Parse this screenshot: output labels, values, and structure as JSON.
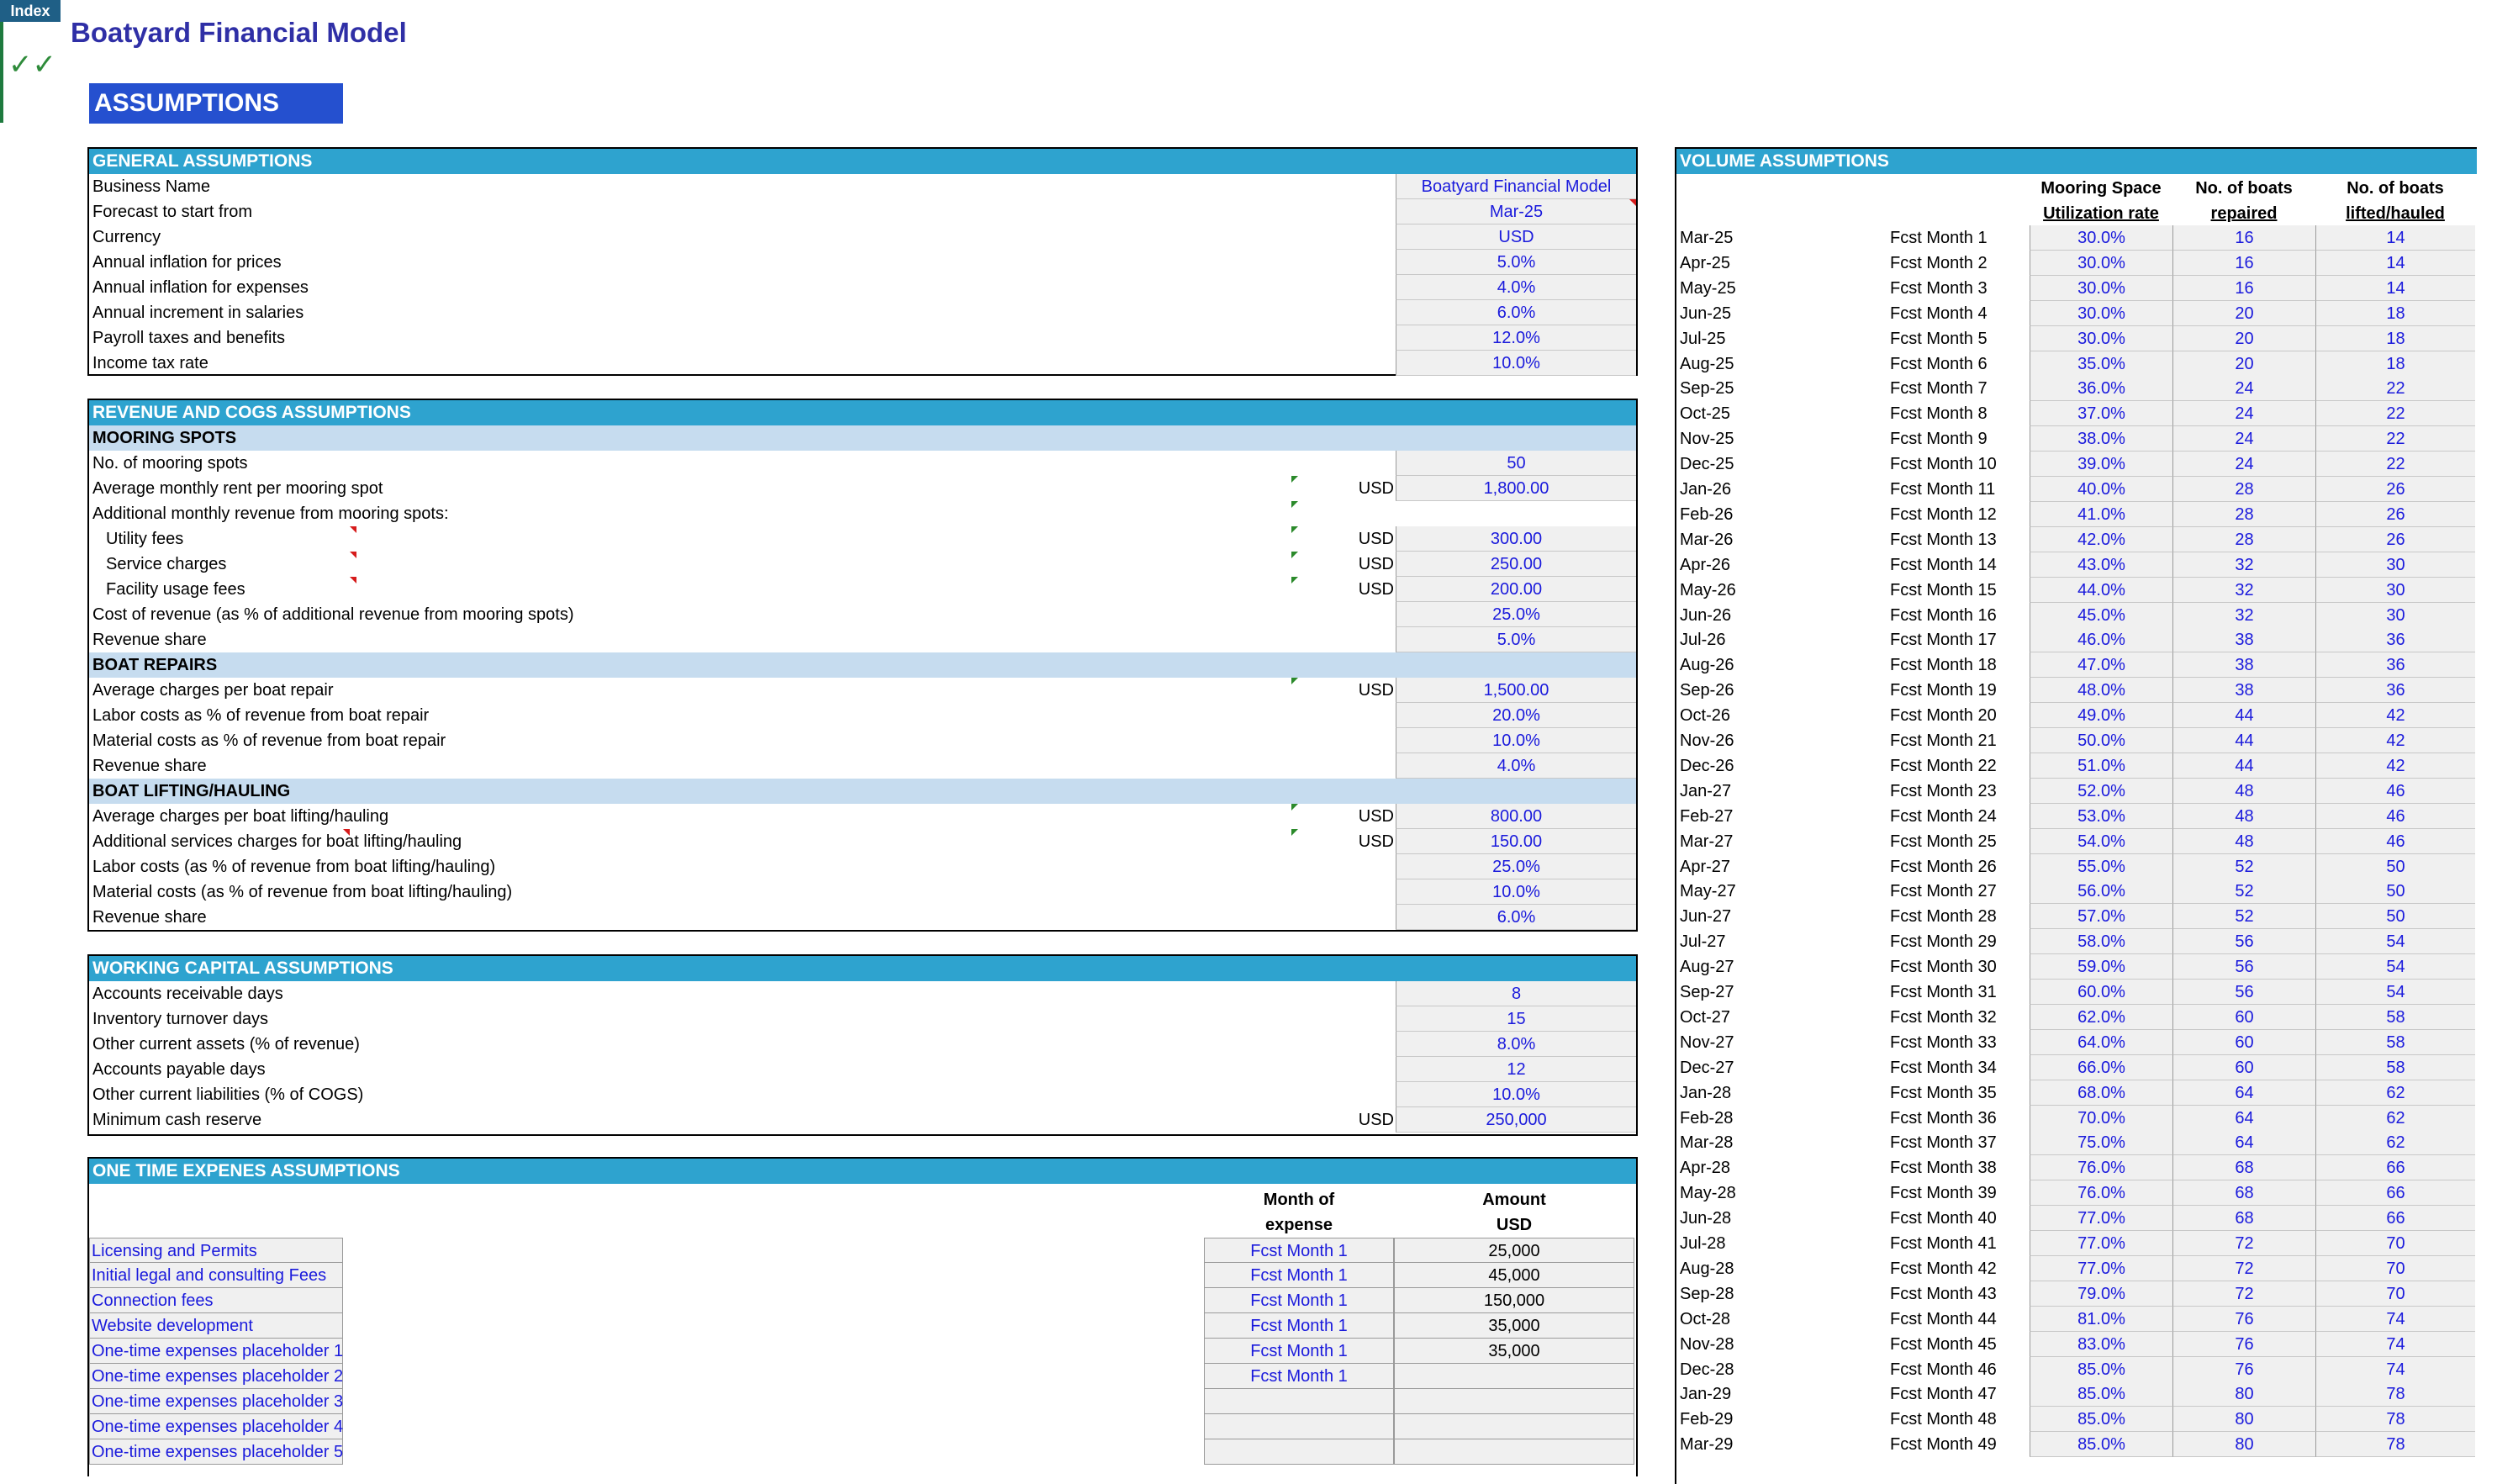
{
  "nav": {
    "index_label": "Index",
    "check_glyph": "✓✓"
  },
  "title": "Boatyard Financial Model",
  "banner": "ASSUMPTIONS",
  "general": {
    "header": "GENERAL ASSUMPTIONS",
    "rows": [
      {
        "label": "Business Name",
        "value": "Boatyard Financial Model"
      },
      {
        "label": "Forecast to start from",
        "value": "Mar-25"
      },
      {
        "label": "Currency",
        "value": "USD"
      },
      {
        "label": "Annual inflation for prices",
        "value": "5.0%"
      },
      {
        "label": "Annual inflation for expenses",
        "value": "4.0%"
      },
      {
        "label": "Annual increment in salaries",
        "value": "6.0%"
      },
      {
        "label": "Payroll taxes and benefits",
        "value": "12.0%"
      },
      {
        "label": "Income tax rate",
        "value": "10.0%"
      }
    ]
  },
  "revenue": {
    "header": "REVENUE AND COGS ASSUMPTIONS",
    "mooring": {
      "header": "MOORING SPOTS",
      "rows": [
        {
          "label": "No. of mooring spots",
          "unit": "",
          "value": "50"
        },
        {
          "label": "Average monthly rent per mooring spot",
          "unit": "USD",
          "value": "1,800.00"
        },
        {
          "label": "Additional monthly revenue from mooring spots:",
          "unit": "",
          "value": ""
        },
        {
          "label": "Utility fees",
          "unit": "USD",
          "value": "300.00"
        },
        {
          "label": "Service charges",
          "unit": "USD",
          "value": "250.00"
        },
        {
          "label": "Facility usage fees",
          "unit": "USD",
          "value": "200.00"
        },
        {
          "label": "Cost of revenue (as % of additional revenue from mooring spots)",
          "unit": "",
          "value": "25.0%"
        },
        {
          "label": "Revenue share",
          "unit": "",
          "value": "5.0%"
        }
      ]
    },
    "repairs": {
      "header": "BOAT REPAIRS",
      "rows": [
        {
          "label": "Average charges per boat repair",
          "unit": "USD",
          "value": "1,500.00"
        },
        {
          "label": "Labor costs as % of revenue from boat repair",
          "unit": "",
          "value": "20.0%"
        },
        {
          "label": "Material costs as % of revenue from boat repair",
          "unit": "",
          "value": "10.0%"
        },
        {
          "label": "Revenue share",
          "unit": "",
          "value": "4.0%"
        }
      ]
    },
    "lifting": {
      "header": "BOAT LIFTING/HAULING",
      "rows": [
        {
          "label": "Average charges per boat lifting/hauling",
          "unit": "USD",
          "value": "800.00"
        },
        {
          "label": "Additional services charges for boat lifting/hauling",
          "unit": "USD",
          "value": "150.00"
        },
        {
          "label": "Labor costs (as % of revenue from boat lifting/hauling)",
          "unit": "",
          "value": "25.0%"
        },
        {
          "label": "Material costs (as % of revenue from boat lifting/hauling)",
          "unit": "",
          "value": "10.0%"
        },
        {
          "label": "Revenue share",
          "unit": "",
          "value": "6.0%"
        }
      ]
    }
  },
  "working_capital": {
    "header": "WORKING CAPITAL ASSUMPTIONS",
    "rows": [
      {
        "label": "Accounts receivable days",
        "unit": "",
        "value": "8"
      },
      {
        "label": "Inventory turnover days",
        "unit": "",
        "value": "15"
      },
      {
        "label": "Other current assets (% of revenue)",
        "unit": "",
        "value": "8.0%"
      },
      {
        "label": "Accounts payable days",
        "unit": "",
        "value": "12"
      },
      {
        "label": "Other current liabilities (% of COGS)",
        "unit": "",
        "value": "10.0%"
      },
      {
        "label": "Minimum cash reserve",
        "unit": "USD",
        "value": "250,000"
      }
    ]
  },
  "one_time": {
    "header": "ONE TIME EXPENES ASSUMPTIONS",
    "col_month_1": "Month of",
    "col_month_2": "expense",
    "col_amount_1": "Amount",
    "col_amount_2": "USD",
    "rows": [
      {
        "name": "Licensing and Permits",
        "month": "Fcst Month 1",
        "amount": "25,000"
      },
      {
        "name": "Initial legal and consulting Fees",
        "month": "Fcst Month 1",
        "amount": "45,000"
      },
      {
        "name": "Connection fees",
        "month": "Fcst Month 1",
        "amount": "150,000"
      },
      {
        "name": "Website development",
        "month": "Fcst Month 1",
        "amount": "35,000"
      },
      {
        "name": "One-time expenses placeholder 1",
        "month": "Fcst Month 1",
        "amount": "35,000"
      },
      {
        "name": "One-time expenses placeholder 2",
        "month": "Fcst Month 1",
        "amount": ""
      },
      {
        "name": "One-time expenses placeholder 3",
        "month": "",
        "amount": ""
      },
      {
        "name": "One-time expenses placeholder 4",
        "month": "",
        "amount": ""
      },
      {
        "name": "One-time expenses placeholder 5",
        "month": "",
        "amount": ""
      }
    ]
  },
  "volume": {
    "header": "VOLUME ASSUMPTIONS",
    "col1_a": "Mooring Space",
    "col1_b": "Utilization rate",
    "col2_a": "No. of boats",
    "col2_b": "repaired",
    "col3_a": "No. of boats",
    "col3_b": "lifted/hauled",
    "rows": [
      [
        "Mar-25",
        "Fcst Month 1",
        "30.0%",
        "16",
        "14"
      ],
      [
        "Apr-25",
        "Fcst Month 2",
        "30.0%",
        "16",
        "14"
      ],
      [
        "May-25",
        "Fcst Month 3",
        "30.0%",
        "16",
        "14"
      ],
      [
        "Jun-25",
        "Fcst Month 4",
        "30.0%",
        "20",
        "18"
      ],
      [
        "Jul-25",
        "Fcst Month 5",
        "30.0%",
        "20",
        "18"
      ],
      [
        "Aug-25",
        "Fcst Month 6",
        "35.0%",
        "20",
        "18"
      ],
      [
        "Sep-25",
        "Fcst Month 7",
        "36.0%",
        "24",
        "22"
      ],
      [
        "Oct-25",
        "Fcst Month 8",
        "37.0%",
        "24",
        "22"
      ],
      [
        "Nov-25",
        "Fcst Month 9",
        "38.0%",
        "24",
        "22"
      ],
      [
        "Dec-25",
        "Fcst Month 10",
        "39.0%",
        "24",
        "22"
      ],
      [
        "Jan-26",
        "Fcst Month 11",
        "40.0%",
        "28",
        "26"
      ],
      [
        "Feb-26",
        "Fcst Month 12",
        "41.0%",
        "28",
        "26"
      ],
      [
        "Mar-26",
        "Fcst Month 13",
        "42.0%",
        "28",
        "26"
      ],
      [
        "Apr-26",
        "Fcst Month 14",
        "43.0%",
        "32",
        "30"
      ],
      [
        "May-26",
        "Fcst Month 15",
        "44.0%",
        "32",
        "30"
      ],
      [
        "Jun-26",
        "Fcst Month 16",
        "45.0%",
        "32",
        "30"
      ],
      [
        "Jul-26",
        "Fcst Month 17",
        "46.0%",
        "38",
        "36"
      ],
      [
        "Aug-26",
        "Fcst Month 18",
        "47.0%",
        "38",
        "36"
      ],
      [
        "Sep-26",
        "Fcst Month 19",
        "48.0%",
        "38",
        "36"
      ],
      [
        "Oct-26",
        "Fcst Month 20",
        "49.0%",
        "44",
        "42"
      ],
      [
        "Nov-26",
        "Fcst Month 21",
        "50.0%",
        "44",
        "42"
      ],
      [
        "Dec-26",
        "Fcst Month 22",
        "51.0%",
        "44",
        "42"
      ],
      [
        "Jan-27",
        "Fcst Month 23",
        "52.0%",
        "48",
        "46"
      ],
      [
        "Feb-27",
        "Fcst Month 24",
        "53.0%",
        "48",
        "46"
      ],
      [
        "Mar-27",
        "Fcst Month 25",
        "54.0%",
        "48",
        "46"
      ],
      [
        "Apr-27",
        "Fcst Month 26",
        "55.0%",
        "52",
        "50"
      ],
      [
        "May-27",
        "Fcst Month 27",
        "56.0%",
        "52",
        "50"
      ],
      [
        "Jun-27",
        "Fcst Month 28",
        "57.0%",
        "52",
        "50"
      ],
      [
        "Jul-27",
        "Fcst Month 29",
        "58.0%",
        "56",
        "54"
      ],
      [
        "Aug-27",
        "Fcst Month 30",
        "59.0%",
        "56",
        "54"
      ],
      [
        "Sep-27",
        "Fcst Month 31",
        "60.0%",
        "56",
        "54"
      ],
      [
        "Oct-27",
        "Fcst Month 32",
        "62.0%",
        "60",
        "58"
      ],
      [
        "Nov-27",
        "Fcst Month 33",
        "64.0%",
        "60",
        "58"
      ],
      [
        "Dec-27",
        "Fcst Month 34",
        "66.0%",
        "60",
        "58"
      ],
      [
        "Jan-28",
        "Fcst Month 35",
        "68.0%",
        "64",
        "62"
      ],
      [
        "Feb-28",
        "Fcst Month 36",
        "70.0%",
        "64",
        "62"
      ],
      [
        "Mar-28",
        "Fcst Month 37",
        "75.0%",
        "64",
        "62"
      ],
      [
        "Apr-28",
        "Fcst Month 38",
        "76.0%",
        "68",
        "66"
      ],
      [
        "May-28",
        "Fcst Month 39",
        "76.0%",
        "68",
        "66"
      ],
      [
        "Jun-28",
        "Fcst Month 40",
        "77.0%",
        "68",
        "66"
      ],
      [
        "Jul-28",
        "Fcst Month 41",
        "77.0%",
        "72",
        "70"
      ],
      [
        "Aug-28",
        "Fcst Month 42",
        "77.0%",
        "72",
        "70"
      ],
      [
        "Sep-28",
        "Fcst Month 43",
        "79.0%",
        "72",
        "70"
      ],
      [
        "Oct-28",
        "Fcst Month 44",
        "81.0%",
        "76",
        "74"
      ],
      [
        "Nov-28",
        "Fcst Month 45",
        "83.0%",
        "76",
        "74"
      ],
      [
        "Dec-28",
        "Fcst Month 46",
        "85.0%",
        "76",
        "74"
      ],
      [
        "Jan-29",
        "Fcst Month 47",
        "85.0%",
        "80",
        "78"
      ],
      [
        "Feb-29",
        "Fcst Month 48",
        "85.0%",
        "80",
        "78"
      ],
      [
        "Mar-29",
        "Fcst Month 49",
        "85.0%",
        "80",
        "78"
      ]
    ]
  }
}
